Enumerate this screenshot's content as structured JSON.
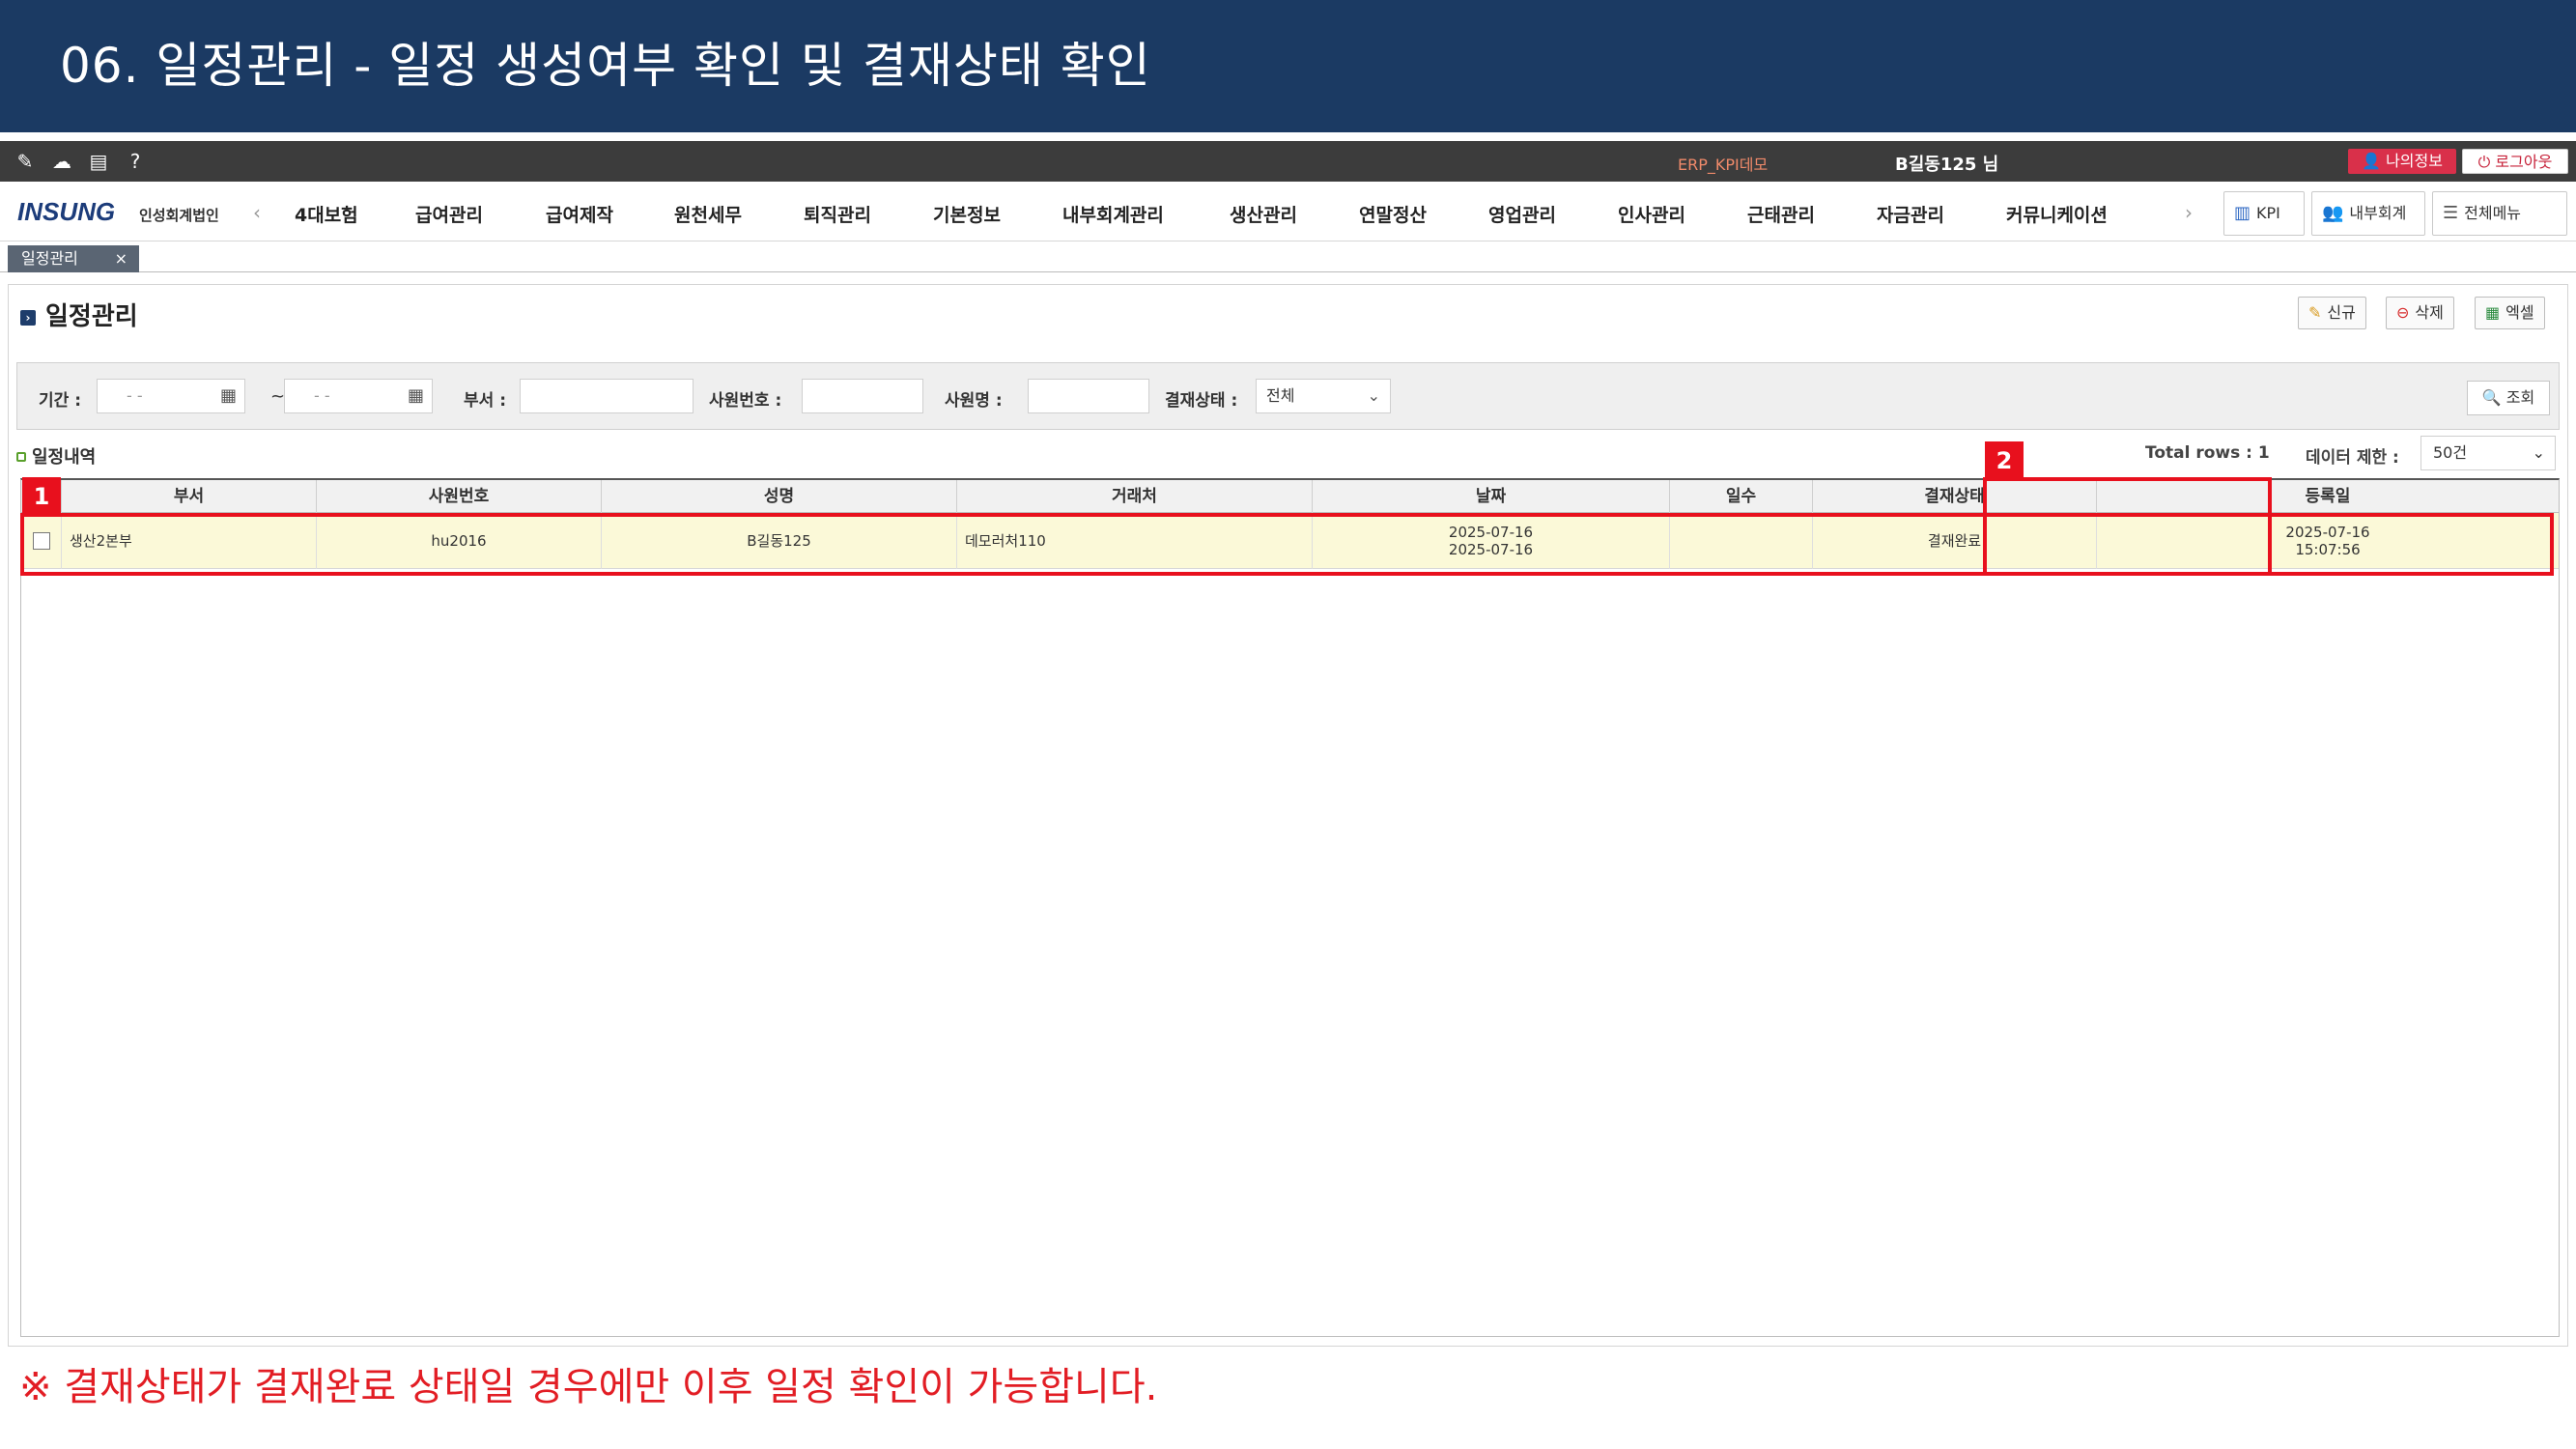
{
  "slide": {
    "title": "06. 일정관리 - 일정 생성여부 확인 및 결재상태 확인",
    "note": "※ 결재상태가 결재완료 상태일 경우에만 이후 일정 확인이 가능합니다."
  },
  "topbar": {
    "icons": [
      "edit-icon",
      "cloud-icon",
      "layout-icon",
      "help-icon"
    ],
    "company": "ERP_KPI데모",
    "user": "B길동125 님",
    "my_info": "나의정보",
    "logout": "로그아웃"
  },
  "nav": {
    "logo": "INSUNG",
    "logo_sub": "인성회계법인",
    "items": [
      "4대보험",
      "급여관리",
      "급여제작",
      "원천세무",
      "퇴직관리",
      "기본정보",
      "내부회계관리",
      "생산관리",
      "연말정산",
      "영업관리",
      "인사관리",
      "근태관리",
      "자금관리",
      "커뮤니케이션"
    ],
    "prev": "‹",
    "next": "›",
    "kpi": "KPI",
    "internal": "내부회계",
    "all_menu": "전체메뉴"
  },
  "tab": {
    "label": "일정관리",
    "close": "×"
  },
  "page": {
    "title": "일정관리",
    "btn_new": "신규",
    "btn_delete": "삭제",
    "btn_excel": "엑셀"
  },
  "search": {
    "period_label": "기간 :",
    "date_from_placeholder": "- -",
    "date_to_placeholder": "- -",
    "tilde": "~",
    "dept_label": "부서 :",
    "empno_label": "사원번호 :",
    "name_label": "사원명 :",
    "status_label": "결재상태 :",
    "status_value": "전체",
    "search_btn": "조회"
  },
  "list": {
    "title": "일정내역",
    "total": "Total rows : 1",
    "limit_label": "데이터 제한 :",
    "limit_value": "50건"
  },
  "grid": {
    "headers": [
      "부서",
      "사원번호",
      "성명",
      "거래처",
      "날짜",
      "일수",
      "결재상태",
      "등록일"
    ],
    "rows": [
      {
        "dept": "생산2본부",
        "empno": "hu2016",
        "name": "B길동125",
        "client": "데모러처110",
        "date_start": "2025-07-16",
        "date_end": "2025-07-16",
        "days": "",
        "status": "결재완료",
        "reg_date": "2025-07-16",
        "reg_time": "15:07:56"
      }
    ]
  },
  "badges": {
    "one": "1",
    "two": "2"
  },
  "colors": {
    "header_bg": "#1b3a63",
    "highlight": "#e8101d",
    "row_selected": "#fbf9d8"
  }
}
